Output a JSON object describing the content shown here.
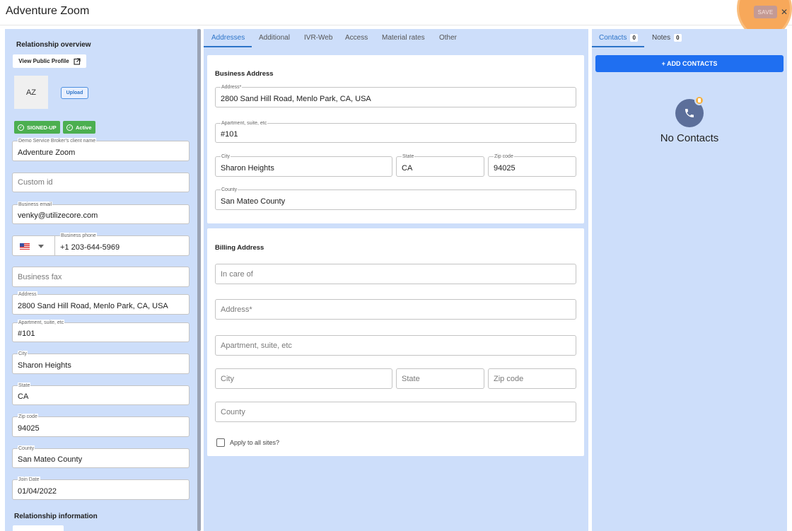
{
  "app": {
    "title": "Adventure Zoom",
    "save_label": "SAVE",
    "close_glyph": "✕"
  },
  "left": {
    "overview_title": "Relationship overview",
    "view_profile_label": "View Public Profile",
    "view_profile_icon": "open-in-new-icon",
    "avatar_initials": "AZ",
    "upload_label": "Upload",
    "badges": [
      {
        "label": "SIGNED-UP",
        "color": "#4caf50"
      },
      {
        "label": "Active",
        "color": "#4caf50"
      }
    ],
    "fields": {
      "client_name": {
        "label": "Demo Service Broker's client name",
        "value": "Adventure Zoom"
      },
      "custom_id": {
        "placeholder": "Custom id"
      },
      "email": {
        "label": "Business email",
        "value": "venky@utilizecore.com"
      },
      "phone": {
        "label": "Business phone",
        "value": "+1 203-644-5969",
        "country": "US"
      },
      "fax": {
        "placeholder": "Business fax"
      },
      "address": {
        "label": "Address",
        "value": "2800 Sand Hill Road, Menlo Park, CA, USA"
      },
      "apartment": {
        "label": "Apartment, suite, etc",
        "value": "#101"
      },
      "city": {
        "label": "City",
        "value": "Sharon Heights"
      },
      "state": {
        "label": "State",
        "value": "CA"
      },
      "zip": {
        "label": "Zip code",
        "value": "94025"
      },
      "county": {
        "label": "County",
        "value": "San Mateo County"
      },
      "join_date": {
        "label": "Join Date",
        "value": "01/04/2022"
      }
    },
    "info_title": "Relationship information"
  },
  "middle": {
    "tabs": [
      "Addresses",
      "Additional",
      "IVR-Web",
      "Access",
      "Material rates",
      "Other"
    ],
    "active_tab": "Addresses",
    "business": {
      "title": "Business Address",
      "address": {
        "label": "Address*",
        "value": "2800 Sand Hill Road, Menlo Park, CA, USA"
      },
      "apartment": {
        "label": "Apartment, suite, etc",
        "value": "#101"
      },
      "city": {
        "label": "City",
        "value": "Sharon Heights"
      },
      "state": {
        "label": "State",
        "value": "CA"
      },
      "zip": {
        "label": "Zip code",
        "value": "94025"
      },
      "county": {
        "label": "County",
        "value": "San Mateo County"
      }
    },
    "billing": {
      "title": "Billing Address",
      "in_care_of": {
        "placeholder": "In care of"
      },
      "address": {
        "placeholder": "Address*"
      },
      "apartment": {
        "placeholder": "Apartment, suite, etc"
      },
      "city": {
        "placeholder": "City"
      },
      "state": {
        "placeholder": "State"
      },
      "zip": {
        "placeholder": "Zip code"
      },
      "county": {
        "placeholder": "County"
      },
      "apply_all_label": "Apply to all sites?"
    }
  },
  "right": {
    "tabs": [
      {
        "label": "Contacts",
        "count": "0"
      },
      {
        "label": "Notes",
        "count": "0"
      }
    ],
    "add_contacts_label": "+ ADD CONTACTS",
    "empty_label": "No Contacts",
    "colors": {
      "accent": "#1f6ff1",
      "panel": "#cddefa"
    }
  }
}
